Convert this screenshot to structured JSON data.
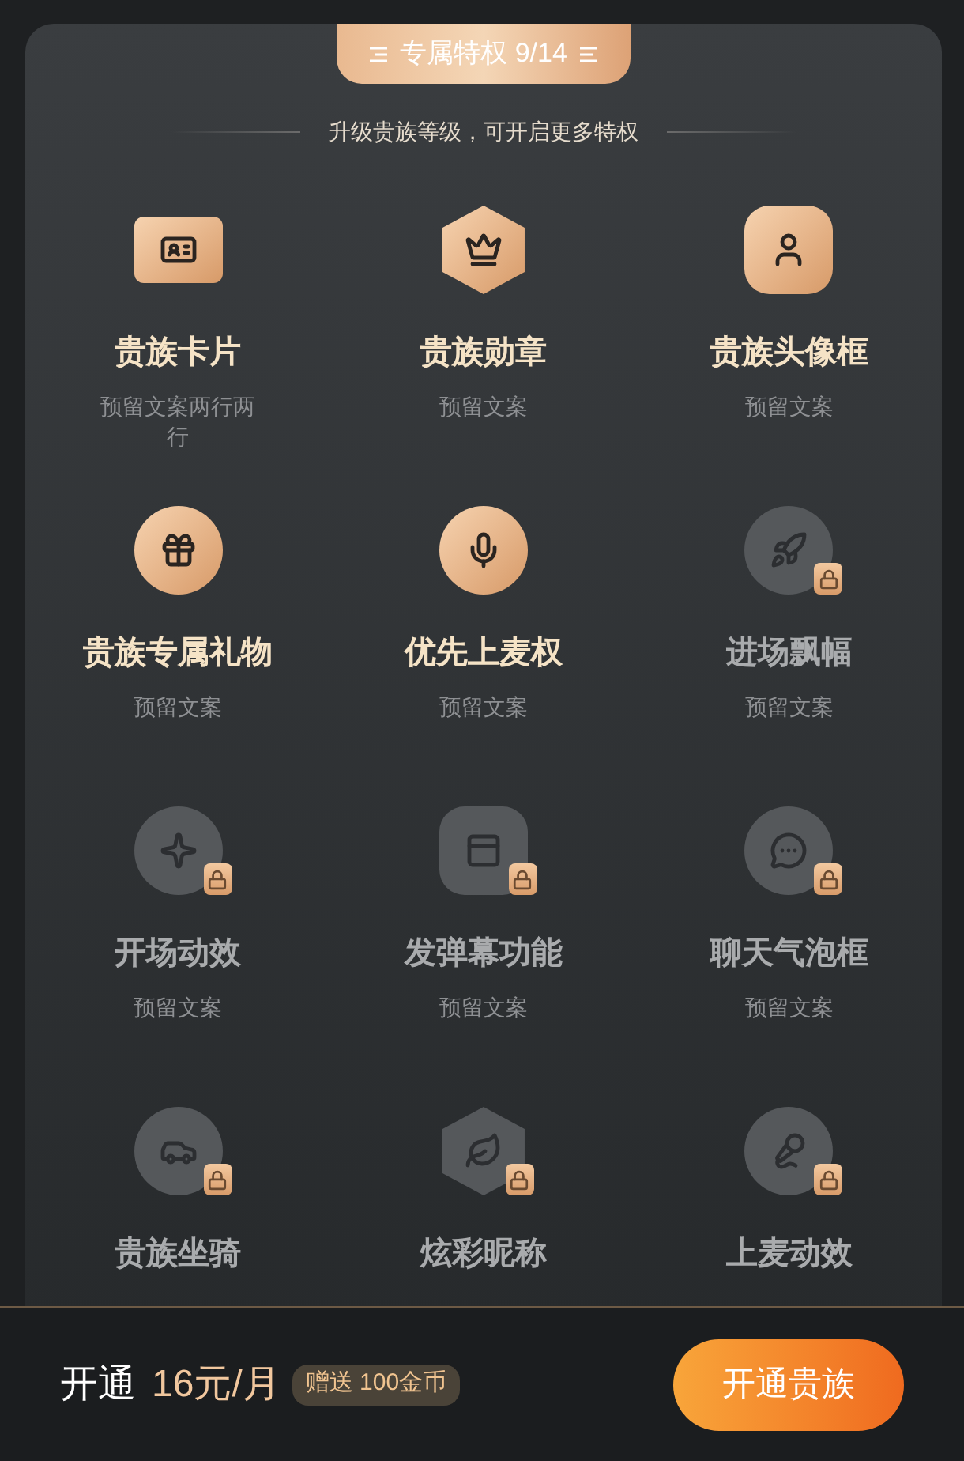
{
  "header": {
    "title": "专属特权 9/14"
  },
  "subtitle": "升级贵族等级，可开启更多特权",
  "privileges": [
    {
      "title": "贵族卡片",
      "description": "预留文案两行两行",
      "locked": false
    },
    {
      "title": "贵族勋章",
      "description": "预留文案",
      "locked": false
    },
    {
      "title": "贵族头像框",
      "description": "预留文案",
      "locked": false
    },
    {
      "title": "贵族专属礼物",
      "description": "预留文案",
      "locked": false
    },
    {
      "title": "优先上麦权",
      "description": "预留文案",
      "locked": false
    },
    {
      "title": "进场飘幅",
      "description": "预留文案",
      "locked": true
    },
    {
      "title": "开场动效",
      "description": "预留文案",
      "locked": true
    },
    {
      "title": "发弹幕功能",
      "description": "预留文案",
      "locked": true
    },
    {
      "title": "聊天气泡框",
      "description": "预留文案",
      "locked": true
    },
    {
      "title": "贵族坐骑",
      "locked": true
    },
    {
      "title": "炫彩昵称",
      "locked": true
    },
    {
      "title": "上麦动效",
      "locked": true
    }
  ],
  "footer": {
    "label": "开通",
    "price": "16元/月",
    "bonus": "赠送 100金币",
    "button": "开通贵族"
  }
}
